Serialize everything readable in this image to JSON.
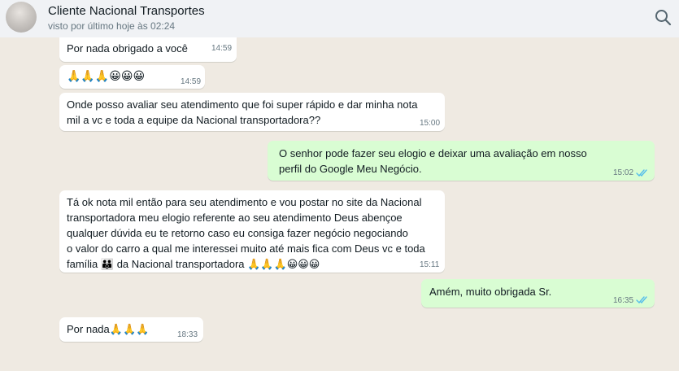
{
  "header": {
    "contact_name": "Cliente Nacional Transportes",
    "status": "visto por último hoje às 02:24",
    "search_icon": "search-icon"
  },
  "colors": {
    "chat_background": "#efeae2",
    "incoming_bubble": "#ffffff",
    "outgoing_bubble": "#d9fdd3",
    "read_ticks": "#53bdeb"
  },
  "messages": [
    {
      "direction": "incoming",
      "text": "Por nada obrigado a você",
      "time": "14:59"
    },
    {
      "direction": "incoming",
      "text": "🙏🙏🙏😀😀😀",
      "time": "14:59"
    },
    {
      "direction": "incoming",
      "text": "Onde posso avaliar  seu atendimento  que foi super rápido e dar minha nota\nmil a vc e toda a equipe da Nacional  transportadora??",
      "time": "15:00"
    },
    {
      "direction": "outgoing",
      "text": "O senhor pode fazer seu elogio e deixar uma avaliação em nosso\nperfil do Google Meu Negócio.",
      "time": "15:02",
      "status": "read"
    },
    {
      "direction": "incoming",
      "text": "Tá ok nota mil então  para seu atendimento  e  vou postar  no site da Nacional\ntransportadora  meu elogio referente ao seu atendimento  Deus abençoe\nqualquer  dúvida  eu te retorno caso eu consiga  fazer  negócio  negociando\no valor do carro a qual me interessei muito  até mais fica com Deus vc e toda\nfamília 👪 da Nacional  transportadora 🙏🙏🙏😀😀😀",
      "time": "15:11"
    },
    {
      "direction": "outgoing",
      "text": "Amém, muito obrigada Sr.",
      "time": "16:35",
      "status": "read"
    },
    {
      "direction": "incoming",
      "text": "Por nada🙏🙏🙏",
      "time": "18:33"
    }
  ]
}
